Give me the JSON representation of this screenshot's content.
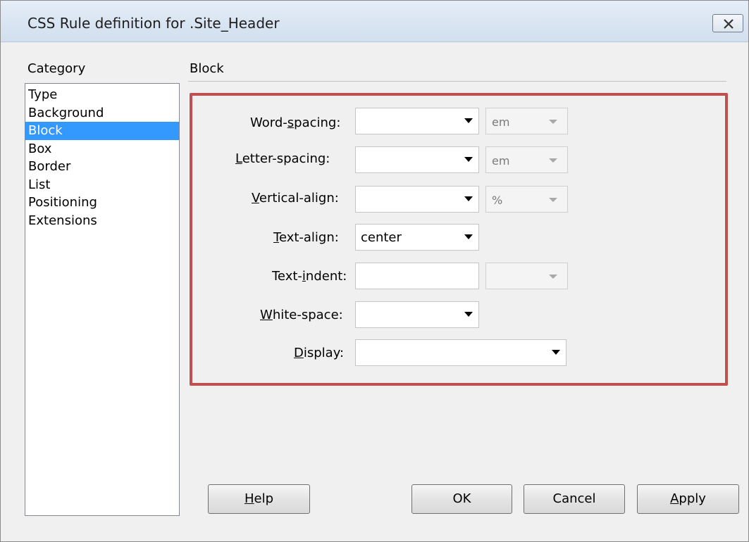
{
  "window": {
    "title": "CSS Rule definition for .Site_Header"
  },
  "category": {
    "label": "Category",
    "items": [
      "Type",
      "Background",
      "Block",
      "Box",
      "Border",
      "List",
      "Positioning",
      "Extensions"
    ],
    "selected": "Block"
  },
  "section": {
    "title": "Block"
  },
  "fields": {
    "word_spacing": {
      "label_pre": "Word-",
      "label_key": "s",
      "label_post": "pacing:",
      "value": "",
      "unit": "em"
    },
    "letter_spacing": {
      "label_pre": "",
      "label_key": "L",
      "label_post": "etter-spacing:",
      "value": "",
      "unit": "em"
    },
    "vertical_align": {
      "label_pre": "",
      "label_key": "V",
      "label_post": "ertical-align:",
      "value": "",
      "unit": "%"
    },
    "text_align": {
      "label_pre": "",
      "label_key": "T",
      "label_post": "ext-align:",
      "value": "center"
    },
    "text_indent": {
      "label_pre": "Text-",
      "label_key": "i",
      "label_post": "ndent:",
      "value": "",
      "unit": ""
    },
    "white_space": {
      "label_pre": "",
      "label_key": "W",
      "label_post": "hite-space:",
      "value": ""
    },
    "display": {
      "label_pre": "",
      "label_key": "D",
      "label_post": "isplay:",
      "value": ""
    }
  },
  "buttons": {
    "help": {
      "key": "H",
      "rest": "elp"
    },
    "ok": "OK",
    "cancel": "Cancel",
    "apply": {
      "key": "A",
      "rest": "pply"
    }
  },
  "colors": {
    "selection": "#3399ff",
    "highlight_border": "#c0504d"
  }
}
